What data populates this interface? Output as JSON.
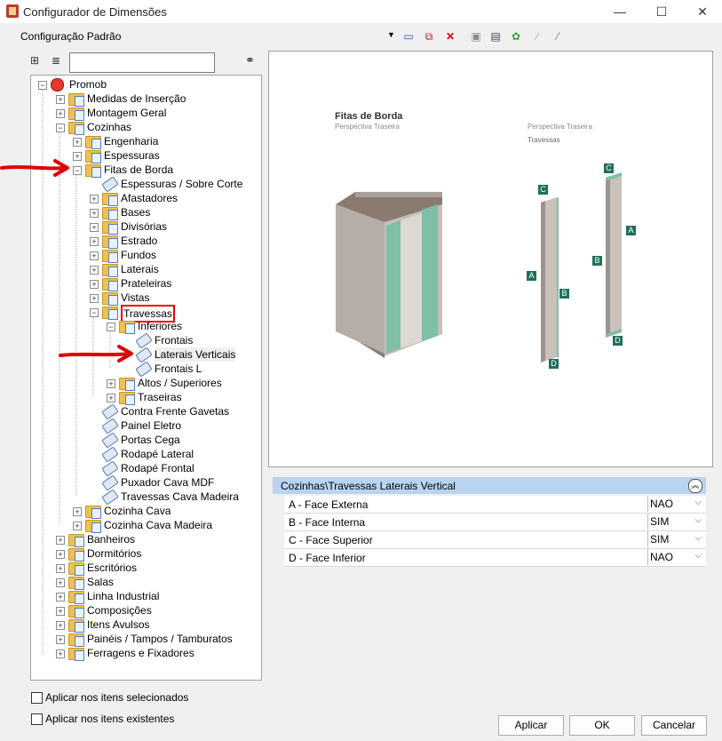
{
  "window": {
    "title": "Configurador de Dimensões",
    "minimize": "—",
    "maximize": "☐",
    "close": "✕"
  },
  "config": {
    "label": "Configuração Padrão"
  },
  "tree": {
    "root": "Promob",
    "items": [
      {
        "label": "Medidas de Inserção"
      },
      {
        "label": "Montagem Geral"
      },
      {
        "label": "Cozinhas"
      },
      {
        "label": "Engenharia"
      },
      {
        "label": "Espessuras"
      },
      {
        "label": "Fitas de Borda"
      },
      {
        "label": "Espessuras / Sobre Corte"
      },
      {
        "label": "Afastadores"
      },
      {
        "label": "Bases"
      },
      {
        "label": "Divisórias"
      },
      {
        "label": "Estrado"
      },
      {
        "label": "Fundos"
      },
      {
        "label": "Laterais"
      },
      {
        "label": "Prateleiras"
      },
      {
        "label": "Vistas"
      },
      {
        "label": "Travessas"
      },
      {
        "label": "Inferiores"
      },
      {
        "label": "Frontais"
      },
      {
        "label": "Laterais Verticais"
      },
      {
        "label": "Frontais L"
      },
      {
        "label": "Altos / Superiores"
      },
      {
        "label": "Traseiras"
      },
      {
        "label": "Contra Frente Gavetas"
      },
      {
        "label": "Painel Eletro"
      },
      {
        "label": "Portas Cega"
      },
      {
        "label": "Rodapé Lateral"
      },
      {
        "label": "Rodapé Frontal"
      },
      {
        "label": "Puxador Cava MDF"
      },
      {
        "label": "Travessas Cava Madeira"
      },
      {
        "label": "Cozinha Cava"
      },
      {
        "label": "Cozinha Cava Madeira"
      },
      {
        "label": "Banheiros"
      },
      {
        "label": "Dormitórios"
      },
      {
        "label": "Escritórios"
      },
      {
        "label": "Salas"
      },
      {
        "label": "Linha Industrial"
      },
      {
        "label": "Composições"
      },
      {
        "label": "Itens Avulsos"
      },
      {
        "label": "Painéis / Tampos / Tamburatos"
      },
      {
        "label": "Ferragens e Fixadores"
      }
    ]
  },
  "preview": {
    "left_title": "Fitas de Borda",
    "left_sub": "Perspectiva Traseira",
    "right_sub": "Perspectiva Traseira",
    "right_title": "Travessas",
    "markers": {
      "a": "A",
      "b": "B",
      "c": "C",
      "d": "D"
    }
  },
  "props": {
    "header": "Cozinhas\\Travessas Laterais Vertical",
    "rows": [
      {
        "label": "A - Face Externa",
        "value": "NAO"
      },
      {
        "label": "B - Face Interna",
        "value": "SIM"
      },
      {
        "label": "C - Face Superior",
        "value": "SIM"
      },
      {
        "label": "D - Face Inferior",
        "value": "NAO"
      }
    ]
  },
  "options": {
    "selected": "Aplicar nos itens selecionados",
    "existing": "Aplicar nos itens existentes"
  },
  "buttons": {
    "apply": "Aplicar",
    "ok": "OK",
    "cancel": "Cancelar"
  },
  "colors": {
    "accent_border": "#e00000",
    "edge_band": "#7fbfa8",
    "panel": "#b8b0a8",
    "marker": "#1f6f5c",
    "header": "#b8d4f0"
  }
}
